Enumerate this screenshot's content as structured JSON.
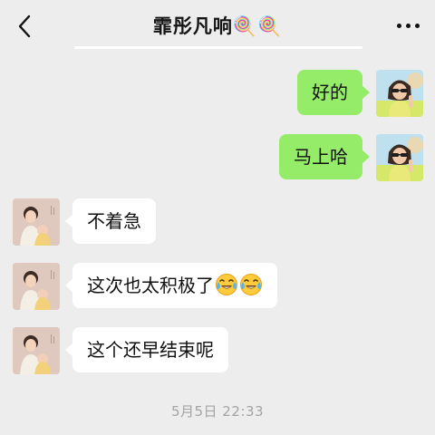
{
  "header": {
    "title": "霏彤凡响🍭🍭",
    "back_icon": "chevron-left-icon",
    "more_icon": "more-dots-icon"
  },
  "messages": [
    {
      "side": "right",
      "text": "好的",
      "bubble_color": "#95ec69"
    },
    {
      "side": "right",
      "text": "马上哈",
      "bubble_color": "#95ec69"
    },
    {
      "side": "left",
      "text": "不着急",
      "bubble_color": "#ffffff"
    },
    {
      "side": "left",
      "text": "这次也太积极了",
      "emojis": [
        "laughing-crying-emoji",
        "laughing-crying-emoji"
      ],
      "bubble_color": "#ffffff"
    },
    {
      "side": "left",
      "text": "这个还早结束呢",
      "bubble_color": "#ffffff"
    }
  ],
  "timestamp": "5月5日 22:33",
  "colors": {
    "background": "#ededed",
    "sent_bubble": "#95ec69",
    "received_bubble": "#ffffff",
    "timestamp_text": "#a3a3a3"
  }
}
